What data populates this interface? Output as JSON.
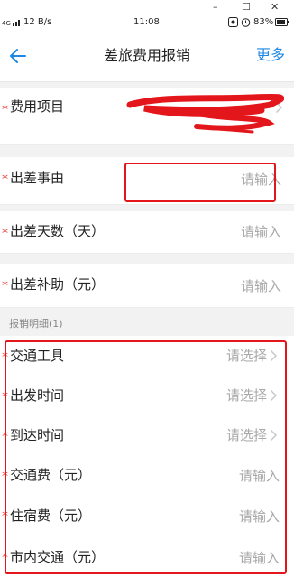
{
  "window": {
    "minimize_glyph": "–",
    "maximize_glyph": "☐",
    "close_glyph": "✕"
  },
  "status_bar": {
    "network": "4G",
    "speed": "12 B/s",
    "time": "11:08",
    "battery": "83%"
  },
  "header": {
    "title": "差旅费用报销",
    "more_label": "更多",
    "back_icon": "arrow-left-icon"
  },
  "form": {
    "required_mark": "*",
    "cost_item": {
      "label": "费用项目",
      "value_state": "redacted-by-red-scribble"
    },
    "trip_reason": {
      "label": "出差事由",
      "placeholder": "请输入"
    },
    "trip_days": {
      "label": "出差天数（天）",
      "placeholder": "请输入"
    },
    "trip_allowance": {
      "label": "出差补助（元）",
      "placeholder": "请输入"
    }
  },
  "details": {
    "section_title": "报销明细(1)",
    "rows": [
      {
        "label": "交通工具",
        "placeholder": "请选择",
        "type": "select"
      },
      {
        "label": "出发时间",
        "placeholder": "请选择",
        "type": "select"
      },
      {
        "label": "到达时间",
        "placeholder": "请选择",
        "type": "select"
      },
      {
        "label": "交通费（元）",
        "placeholder": "请输入",
        "type": "input"
      },
      {
        "label": "住宿费（元）",
        "placeholder": "请输入",
        "type": "input"
      },
      {
        "label": "市内交通（元）",
        "placeholder": "请输入",
        "type": "input"
      }
    ]
  },
  "colors": {
    "accent": "#1e88e5",
    "required": "#e53935",
    "annotation_red": "#e3161b",
    "placeholder": "#a8a8a8"
  }
}
